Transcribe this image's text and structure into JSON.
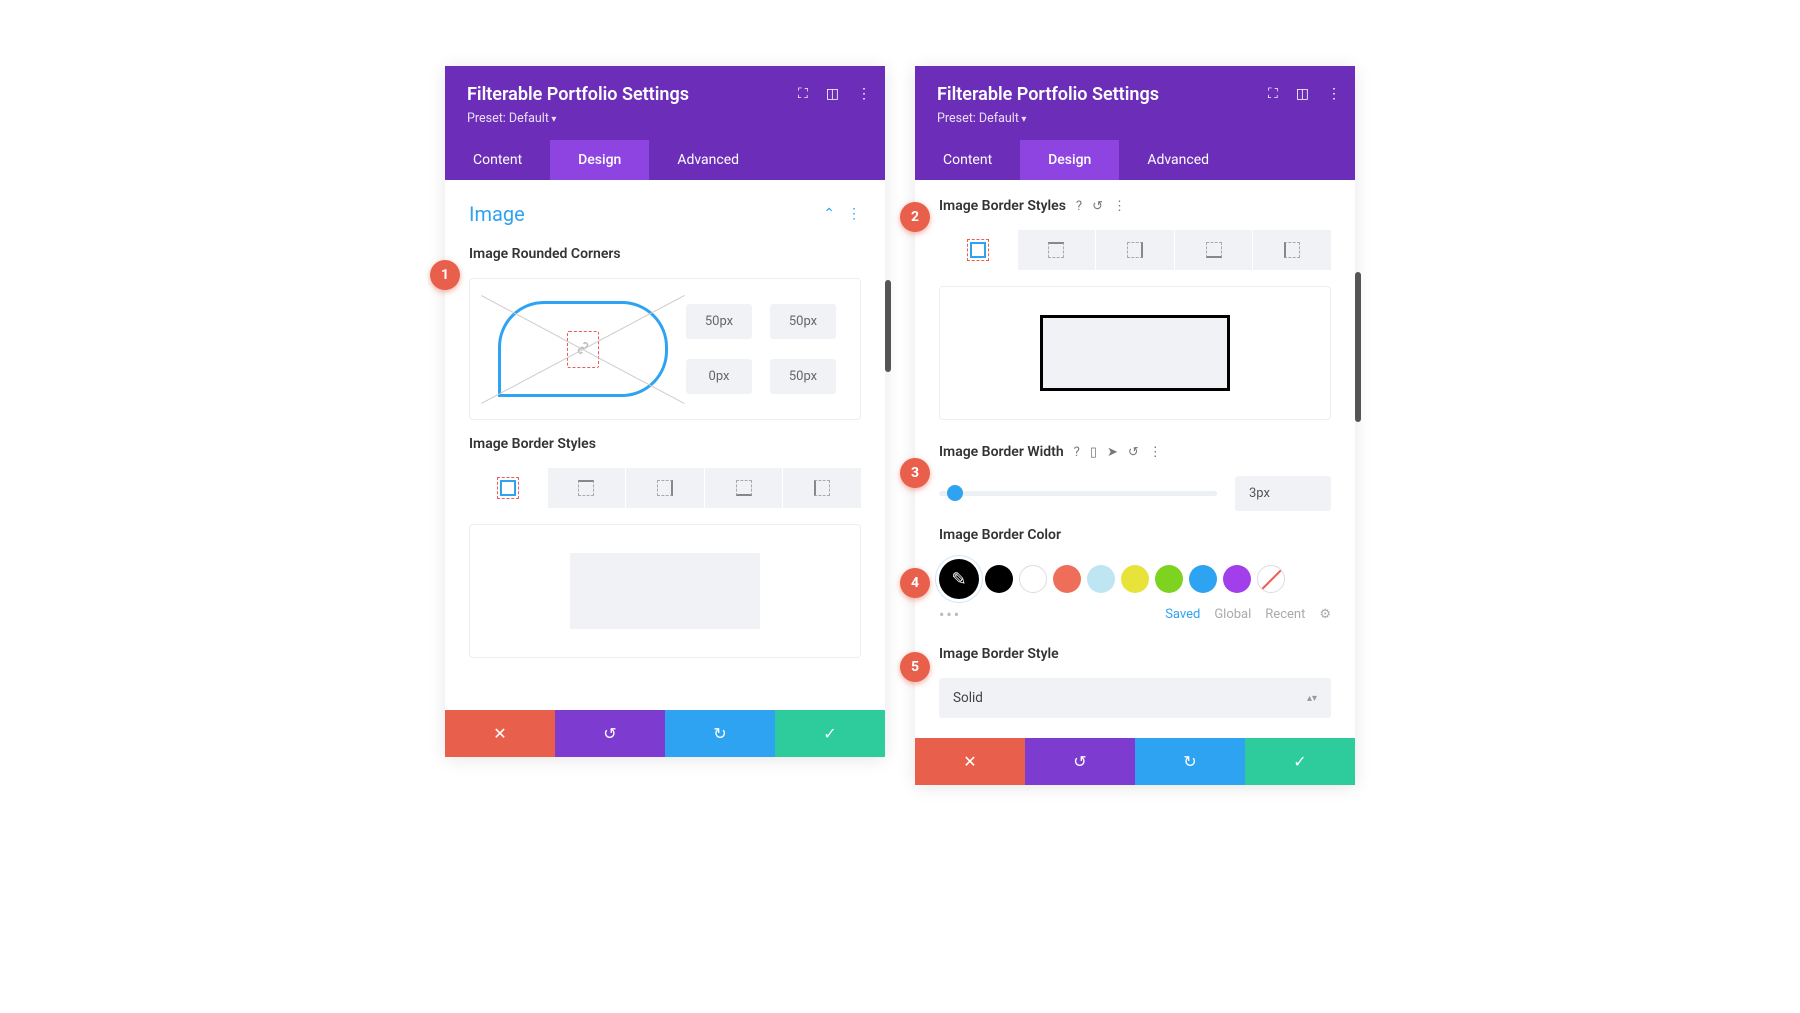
{
  "header": {
    "title": "Filterable Portfolio Settings",
    "preset": "Preset: Default"
  },
  "tabs": [
    "Content",
    "Design",
    "Advanced"
  ],
  "activeTab": "Design",
  "section": {
    "title": "Image"
  },
  "corners": {
    "label": "Image Rounded Corners",
    "tl": "50px",
    "tr": "50px",
    "bl": "0px",
    "br": "50px"
  },
  "borderStyles": {
    "label": "Image Border Styles"
  },
  "borderWidth": {
    "label": "Image Border Width",
    "value": "3px"
  },
  "borderColor": {
    "label": "Image Border Color",
    "palette": [
      "#000000",
      "#ffffff",
      "#ef6e5a",
      "#bde6f2",
      "#e8e33a",
      "#7ed321",
      "#2ea3f2",
      "#a23eea",
      "none"
    ],
    "tabs": {
      "saved": "Saved",
      "global": "Global",
      "recent": "Recent"
    }
  },
  "borderStyle": {
    "label": "Image Border Style",
    "value": "Solid"
  },
  "callouts": [
    "1",
    "2",
    "3",
    "4",
    "5"
  ]
}
